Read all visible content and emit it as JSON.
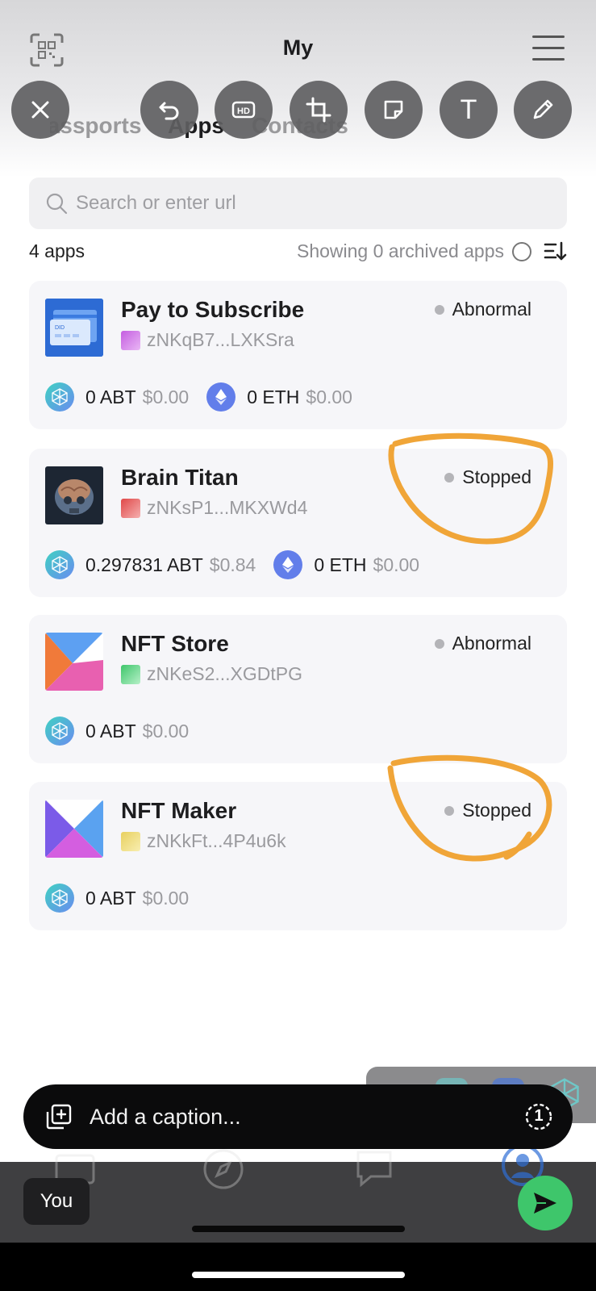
{
  "header": {
    "title": "My",
    "tabs": [
      {
        "label": "Passports"
      },
      {
        "label": "Apps"
      },
      {
        "label": "Contacts"
      }
    ]
  },
  "edit_toolbar": {
    "tools": [
      "close-icon",
      "undo-icon",
      "hd-icon",
      "crop-icon",
      "sticker-icon",
      "text-icon",
      "pen-icon"
    ],
    "text_tool_label": "T",
    "hd_label": "HD"
  },
  "search": {
    "placeholder": "Search or enter url",
    "value": ""
  },
  "summary": {
    "apps_count": "4 apps",
    "archived_label": "Showing 0 archived apps"
  },
  "apps": [
    {
      "name": "Pay to Subscribe",
      "id": "zNKqB7...LXKSra",
      "status": "Abnormal",
      "tokens": [
        {
          "amount": "0 ABT",
          "usd": "$0.00",
          "icon": "abt-token-icon"
        },
        {
          "amount": "0 ETH",
          "usd": "$0.00",
          "icon": "eth-token-icon"
        }
      ]
    },
    {
      "name": "Brain Titan",
      "id": "zNKsP1...MKXWd4",
      "status": "Stopped",
      "tokens": [
        {
          "amount": "0.297831 ABT",
          "usd": "$0.84",
          "icon": "abt-token-icon"
        },
        {
          "amount": "0 ETH",
          "usd": "$0.00",
          "icon": "eth-token-icon"
        }
      ]
    },
    {
      "name": "NFT Store",
      "id": "zNKeS2...XGDtPG",
      "status": "Abnormal",
      "tokens": [
        {
          "amount": "0 ABT",
          "usd": "$0.00",
          "icon": "abt-token-icon"
        }
      ]
    },
    {
      "name": "NFT Maker",
      "id": "zNKkFt...4P4u6k",
      "status": "Stopped",
      "tokens": [
        {
          "amount": "0 ABT",
          "usd": "$0.00",
          "icon": "abt-token-icon"
        }
      ]
    }
  ],
  "thumb_labels": {
    "did": "DID"
  },
  "composer": {
    "caption_placeholder": "Add a caption...",
    "recipient": "You",
    "timer_label": "1"
  },
  "colors": {
    "annotation": "#f0a538",
    "send_button": "#3ec66b",
    "toolbar_button": "#5f5f62"
  }
}
